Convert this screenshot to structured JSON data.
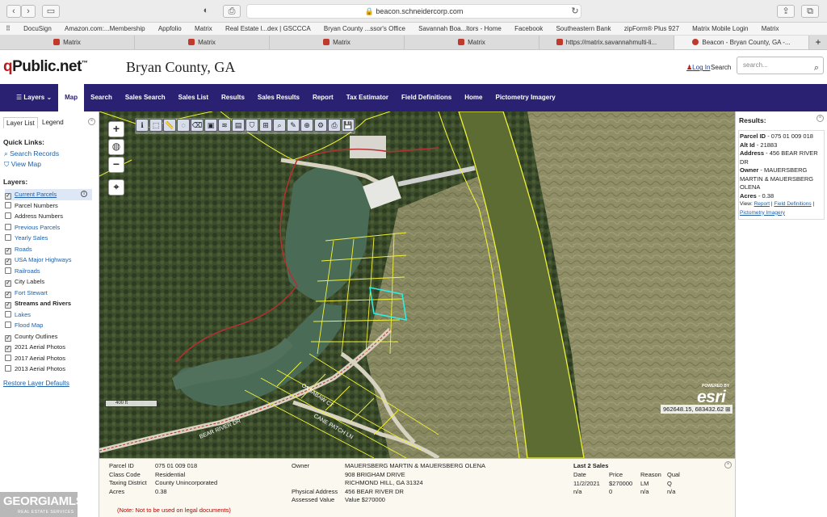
{
  "browser": {
    "url": "beacon.schneidercorp.com",
    "bookmarks": [
      "DocuSign",
      "Amazon.com:...Membership",
      "Appfolio",
      "Matrix",
      "Real Estate l...dex | GSCCCA",
      "Bryan County ...ssor's Office",
      "Savannah Boa...ltors - Home",
      "Facebook",
      "Southeastern Bank",
      "zipForm® Plus 927",
      "Matrix Mobile Login",
      "Matrix"
    ],
    "tabs": [
      "Matrix",
      "Matrix",
      "Matrix",
      "Matrix",
      "https://matrix.savannahmulti-li...",
      "Beacon - Bryan County, GA -..."
    ]
  },
  "header": {
    "logo_q": "q",
    "logo_rest": "Public.net",
    "logo_tm": "™",
    "county": "Bryan County, GA",
    "login": "Log In",
    "search_label": "Search",
    "search_placeholder": "search..."
  },
  "nav": [
    "Layers",
    "Map",
    "Search",
    "Sales Search",
    "Sales List",
    "Results",
    "Sales Results",
    "Report",
    "Tax Estimator",
    "Field Definitions",
    "Home",
    "Pictometry Imagery"
  ],
  "left": {
    "tab_layer_list": "Layer List",
    "tab_legend": "Legend",
    "quick_links_title": "Quick Links:",
    "quick_links": [
      "Search Records",
      "View Map"
    ],
    "layers_title": "Layers:",
    "layers": [
      {
        "label": "Current Parcels",
        "checked": true,
        "link": true,
        "highlighted": true
      },
      {
        "label": "Parcel Numbers",
        "checked": false,
        "link": false
      },
      {
        "label": "Address Numbers",
        "checked": false,
        "link": false
      },
      {
        "label": "Previous Parcels",
        "checked": false,
        "link": true
      },
      {
        "label": "Yearly Sales",
        "checked": false,
        "link": true
      },
      {
        "label": "Roads",
        "checked": true,
        "link": true
      },
      {
        "label": "USA Major Highways",
        "checked": true,
        "link": true
      },
      {
        "label": "Railroads",
        "checked": false,
        "link": true
      },
      {
        "label": "City Labels",
        "checked": true,
        "link": false
      },
      {
        "label": "Fort Stewart",
        "checked": true,
        "link": true
      },
      {
        "label": "Streams and Rivers",
        "checked": true,
        "link": false,
        "bold": true
      },
      {
        "label": "Lakes",
        "checked": false,
        "link": true
      },
      {
        "label": "Flood Map",
        "checked": false,
        "link": true
      },
      {
        "label": "County Outlines",
        "checked": true,
        "link": false
      },
      {
        "label": "2021 Aerial Photos",
        "checked": true,
        "link": false
      },
      {
        "label": "2017 Aerial Photos",
        "checked": false,
        "link": false
      },
      {
        "label": "2013 Aerial Photos",
        "checked": false,
        "link": false
      }
    ],
    "restore": "Restore Layer Defaults"
  },
  "map": {
    "scale_label": "400 ft",
    "powered_by": "POWERED BY",
    "esri": "esri",
    "coords": "962648.15, 683432.62",
    "road_labels": [
      "BEAR RIVER DR",
      "OSSABAW CT",
      "CANE PATCH LN"
    ]
  },
  "results": {
    "title": "Results:",
    "parcel_id_label": "Parcel ID",
    "parcel_id": "075 01 009 018",
    "alt_id_label": "Alt Id",
    "alt_id": "21883",
    "address_label": "Address",
    "address": "456 BEAR RIVER DR",
    "owner_label": "Owner",
    "owner": "MAUERSBERG MARTIN & MAUERSBERG OLENA",
    "acres_label": "Acres",
    "acres": "0.38",
    "view_label": "View:",
    "view_links": [
      "Report",
      "Field Definitions",
      "Pictometry Imagery"
    ]
  },
  "details": {
    "labels": [
      "Parcel ID",
      "Class Code",
      "Taxing District",
      "Acres"
    ],
    "values": [
      "075 01 009 018",
      "Residential",
      "County Unincorporated",
      "0.38"
    ],
    "owner_label": "Owner",
    "owner_lines": [
      "MAUERSBERG MARTIN & MAUERSBERG OLENA",
      "908 BRIGHAM DRIVE",
      "RICHMOND HILL, GA 31324"
    ],
    "physical_address_label": "Physical Address",
    "physical_address": "456 BEAR RIVER DR",
    "assessed_label": "Assessed Value",
    "assessed_value": "Value $270000",
    "sales_title": "Last 2 Sales",
    "sales_headers": [
      "Date",
      "Price",
      "Reason",
      "Qual"
    ],
    "sales_rows": [
      [
        "11/2/2021",
        "$270000",
        "LM",
        "Q"
      ],
      [
        "n/a",
        "0",
        "n/a",
        "n/a"
      ]
    ],
    "note": "(Note: Not to be used on legal documents)"
  },
  "watermark": {
    "title": "GEORGIAMLS",
    "subtitle": "REAL ESTATE SERVICES"
  }
}
